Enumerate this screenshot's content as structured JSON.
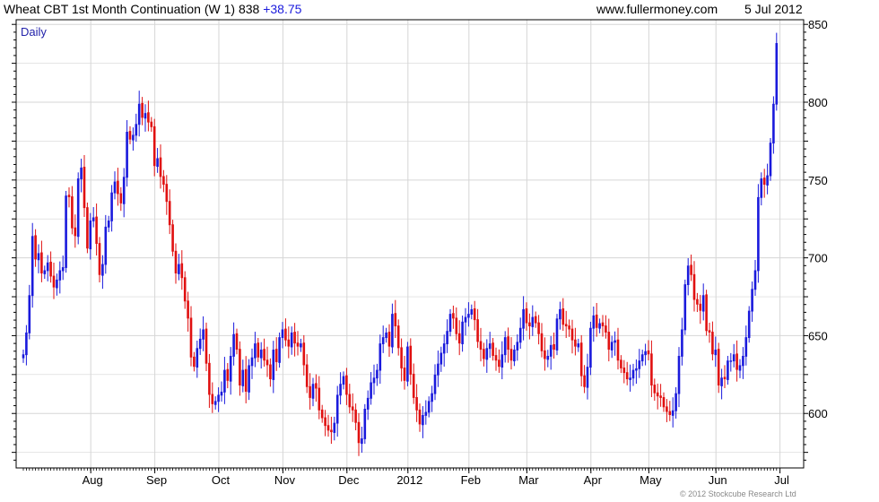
{
  "header": {
    "title": "Wheat CBT 1st Month Continuation (W 1) 838",
    "change": "+38.75",
    "site": "www.fullermoney.com",
    "date": "5 Jul 2012"
  },
  "period_label": "Daily",
  "copyright": "© 2012 Stockcube Research Ltd",
  "colors": {
    "up": "#1a1adc",
    "down": "#e01010",
    "grid": "#d6d6d6",
    "change_text": "#1a1adc"
  },
  "chart_data": {
    "type": "ohlc",
    "ylim": [
      565,
      853
    ],
    "yticks": [
      600,
      650,
      700,
      750,
      800,
      850
    ],
    "grid": true,
    "months": [
      {
        "label": "Aug",
        "index": 23
      },
      {
        "label": "Sep",
        "index": 44
      },
      {
        "label": "Oct",
        "index": 65
      },
      {
        "label": "Nov",
        "index": 86
      },
      {
        "label": "Dec",
        "index": 107
      },
      {
        "label": "2012",
        "index": 127
      },
      {
        "label": "Feb",
        "index": 147
      },
      {
        "label": "Mar",
        "index": 166
      },
      {
        "label": "Apr",
        "index": 187
      },
      {
        "label": "May",
        "index": 206
      },
      {
        "label": "Jun",
        "index": 228
      },
      {
        "label": "Jul",
        "index": 249
      }
    ],
    "closes": [
      638,
      652,
      676,
      714,
      699,
      703,
      690,
      692,
      697,
      688,
      681,
      686,
      692,
      694,
      740,
      739,
      719,
      714,
      751,
      758,
      732,
      706,
      724,
      726,
      709,
      689,
      696,
      720,
      724,
      742,
      749,
      741,
      735,
      752,
      781,
      776,
      779,
      786,
      799,
      790,
      793,
      787,
      784,
      759,
      764,
      752,
      747,
      736,
      721,
      704,
      690,
      696,
      687,
      672,
      661,
      636,
      630,
      642,
      648,
      654,
      632,
      612,
      606,
      608,
      612,
      614,
      628,
      621,
      637,
      651,
      641,
      618,
      628,
      614,
      631,
      636,
      645,
      636,
      641,
      634,
      631,
      622,
      641,
      633,
      649,
      654,
      647,
      643,
      652,
      645,
      643,
      645,
      631,
      617,
      610,
      619,
      616,
      602,
      597,
      592,
      589,
      588,
      594,
      612,
      619,
      624,
      612,
      604,
      602,
      594,
      581,
      584,
      603,
      610,
      620,
      623,
      628,
      645,
      649,
      652,
      643,
      664,
      656,
      642,
      629,
      621,
      643,
      625,
      610,
      602,
      593,
      599,
      601,
      608,
      613,
      625,
      632,
      639,
      645,
      653,
      664,
      661,
      651,
      645,
      659,
      662,
      664,
      667,
      660,
      646,
      641,
      635,
      642,
      645,
      637,
      634,
      630,
      638,
      649,
      641,
      634,
      641,
      646,
      655,
      667,
      658,
      656,
      662,
      658,
      651,
      640,
      635,
      637,
      644,
      641,
      661,
      667,
      657,
      656,
      654,
      647,
      643,
      645,
      624,
      617,
      630,
      655,
      663,
      655,
      658,
      656,
      652,
      641,
      646,
      647,
      634,
      629,
      626,
      622,
      623,
      628,
      629,
      634,
      638,
      640,
      638,
      618,
      613,
      611,
      610,
      604,
      601,
      599,
      602,
      613,
      637,
      654,
      683,
      695,
      689,
      673,
      670,
      666,
      676,
      653,
      652,
      638,
      641,
      618,
      623,
      622,
      634,
      634,
      638,
      628,
      631,
      637,
      649,
      666,
      680,
      692,
      739,
      751,
      747,
      753,
      774,
      799,
      838
    ]
  }
}
